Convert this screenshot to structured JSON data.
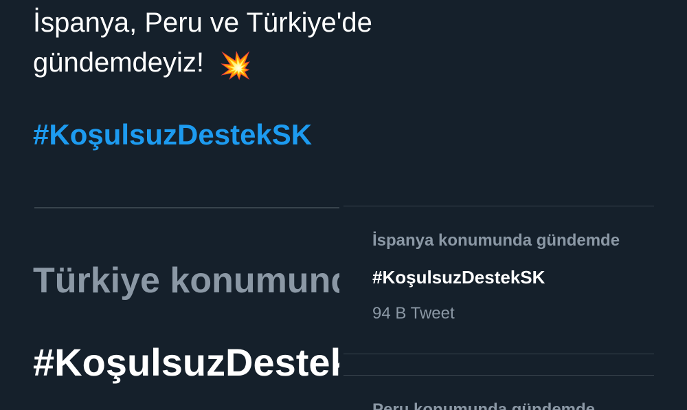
{
  "tweet": {
    "line1": "İspanya, Peru ve Türkiye'de",
    "line2": "gündemdeyiz!",
    "emoji": "💥",
    "hashtag": "#KoşulsuzDestekSK"
  },
  "left_trend": {
    "location": "Türkiye konumunda gündemde",
    "tag": "#KoşulsuzDestekSK"
  },
  "right_trends": {
    "items": [
      {
        "location": "İspanya konumunda gündemde",
        "tag": "#KoşulsuzDestekSK",
        "count": "94 B Tweet"
      },
      {
        "location": "Peru konumunda gündemde"
      }
    ]
  },
  "colors": {
    "background": "#15202b",
    "hashtag_blue": "#1d9bf0",
    "secondary_text": "#8b98a5",
    "divider": "#38444d"
  }
}
